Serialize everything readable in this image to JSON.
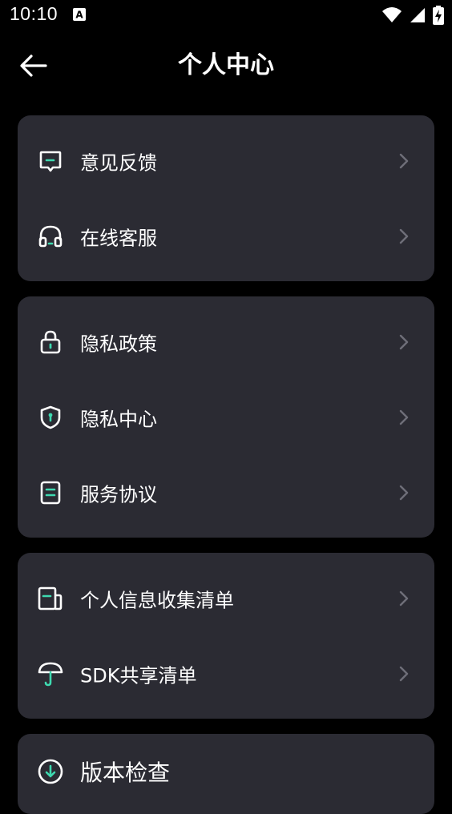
{
  "status_bar": {
    "time": "10:10",
    "icons": [
      "notification-a-icon",
      "wifi-icon",
      "signal-icon",
      "battery-charging-icon"
    ]
  },
  "header": {
    "title": "个人中心",
    "back_icon": "arrow-left-icon"
  },
  "colors": {
    "background": "#000000",
    "card": "#2b2b33",
    "accent": "#3ed9b0",
    "chevron": "#6e6e78"
  },
  "groups": [
    {
      "items": [
        {
          "label": "意见反馈",
          "icon": "feedback-icon"
        },
        {
          "label": "在线客服",
          "icon": "headset-icon"
        }
      ]
    },
    {
      "items": [
        {
          "label": "隐私政策",
          "icon": "lock-icon"
        },
        {
          "label": "隐私中心",
          "icon": "shield-icon"
        },
        {
          "label": "服务协议",
          "icon": "document-icon"
        }
      ]
    },
    {
      "items": [
        {
          "label": "个人信息收集清单",
          "icon": "info-list-icon"
        },
        {
          "label": "SDK共享清单",
          "icon": "umbrella-icon"
        }
      ]
    },
    {
      "items": [
        {
          "label": "版本检查",
          "icon": "download-circle-icon"
        }
      ]
    }
  ]
}
